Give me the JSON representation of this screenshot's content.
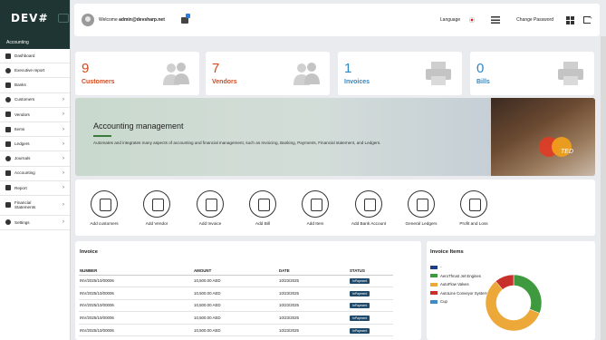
{
  "app": {
    "logo_text": "DEV#"
  },
  "sidebar": {
    "section_label": "Accounting",
    "items": [
      {
        "label": "Dashboard",
        "icon": "dashboard-icon",
        "chevron": false
      },
      {
        "label": "Executive report",
        "icon": "report-icon",
        "chevron": false
      },
      {
        "label": "Banks",
        "icon": "bank-icon",
        "chevron": false
      },
      {
        "label": "Customers",
        "icon": "users-icon",
        "chevron": true
      },
      {
        "label": "Vendors",
        "icon": "truck-icon",
        "chevron": true
      },
      {
        "label": "Items",
        "icon": "list-icon",
        "chevron": true
      },
      {
        "label": "Ledgers",
        "icon": "ledger-icon",
        "chevron": true
      },
      {
        "label": "Journals",
        "icon": "book-icon",
        "chevron": true
      },
      {
        "label": "Accounting",
        "icon": "calculator-icon",
        "chevron": true
      },
      {
        "label": "Report",
        "icon": "chart-icon",
        "chevron": true
      },
      {
        "label": "Financial Statements",
        "icon": "document-icon",
        "chevron": true
      },
      {
        "label": "Settings",
        "icon": "gear-icon",
        "chevron": true
      }
    ]
  },
  "topbar": {
    "welcome_prefix": "Welcome",
    "user": "admin@devsharp.net",
    "language_label": "Language",
    "change_password_label": "Change Password"
  },
  "stats": [
    {
      "value": "9",
      "label": "Customers",
      "color": "#d44a1e",
      "icon": "people-icon"
    },
    {
      "value": "7",
      "label": "Vendors",
      "color": "#d44a1e",
      "icon": "people-icon"
    },
    {
      "value": "1",
      "label": "Invoices",
      "color": "#2e87c6",
      "icon": "printer-icon"
    },
    {
      "value": "0",
      "label": "Bills",
      "color": "#2e87c6",
      "icon": "printer-icon"
    }
  ],
  "banner": {
    "title": "Accounting management",
    "description": "Automates and integrates many aspects of accounting and financial management, such as Invoicing, Banking, Payments, Financial statement, and Ledgers.",
    "card_text": "TED"
  },
  "quick_actions": [
    {
      "label": "Add customers",
      "icon": "add-customer-icon"
    },
    {
      "label": "Add Vendor",
      "icon": "add-vendor-icon"
    },
    {
      "label": "Add Invoice",
      "icon": "add-invoice-icon"
    },
    {
      "label": "Add Bill",
      "icon": "add-bill-icon"
    },
    {
      "label": "Add Item",
      "icon": "add-item-icon"
    },
    {
      "label": "Add Bank Account",
      "icon": "bank-account-icon"
    },
    {
      "label": "General Ledgers",
      "icon": "ledger-icon"
    },
    {
      "label": "Profit and Loss",
      "icon": "profit-loss-icon"
    }
  ],
  "invoice": {
    "title": "Invoice",
    "columns": [
      "NUMBER",
      "AMOUNT",
      "DATE",
      "STATUS"
    ],
    "rows": [
      {
        "number": "INV/2025/10/00006",
        "amount": "10,500.00 AED",
        "date": "10/23/2025",
        "status": "InPayment"
      },
      {
        "number": "INV/2025/10/00006",
        "amount": "10,500.00 AED",
        "date": "10/23/2025",
        "status": "InPayment"
      },
      {
        "number": "INV/2025/10/00006",
        "amount": "10,500.00 AED",
        "date": "10/23/2025",
        "status": "InPayment"
      },
      {
        "number": "INV/2025/10/00006",
        "amount": "10,500.00 AED",
        "date": "10/23/2025",
        "status": "InPayment"
      },
      {
        "number": "INV/2025/10/00006",
        "amount": "10,500.00 AED",
        "date": "10/23/2025",
        "status": "InPayment"
      }
    ]
  },
  "invoice_items": {
    "title": "Invoice Items",
    "legend": [
      {
        "label": "-",
        "color": "#1f3e8a"
      },
      {
        "label": "AeroThrust Jet Engines",
        "color": "#3f9a3f"
      },
      {
        "label": "AutoFlow Valves",
        "color": "#eda83a"
      },
      {
        "label": "AutoLine Conveyor Systems",
        "color": "#c8302c"
      },
      {
        "label": "Cup",
        "color": "#3a8bc9"
      }
    ]
  },
  "chart_data": {
    "type": "pie",
    "categories": [
      "-",
      "AeroThrust Jet Engines",
      "AutoFlow Valves",
      "AutoLine Conveyor Systems",
      "Cup"
    ],
    "values": [
      0,
      31,
      58,
      11,
      0
    ],
    "colors": [
      "#1f3e8a",
      "#3f9a3f",
      "#eda83a",
      "#c8302c",
      "#3a8bc9"
    ],
    "title": "Invoice Items"
  }
}
